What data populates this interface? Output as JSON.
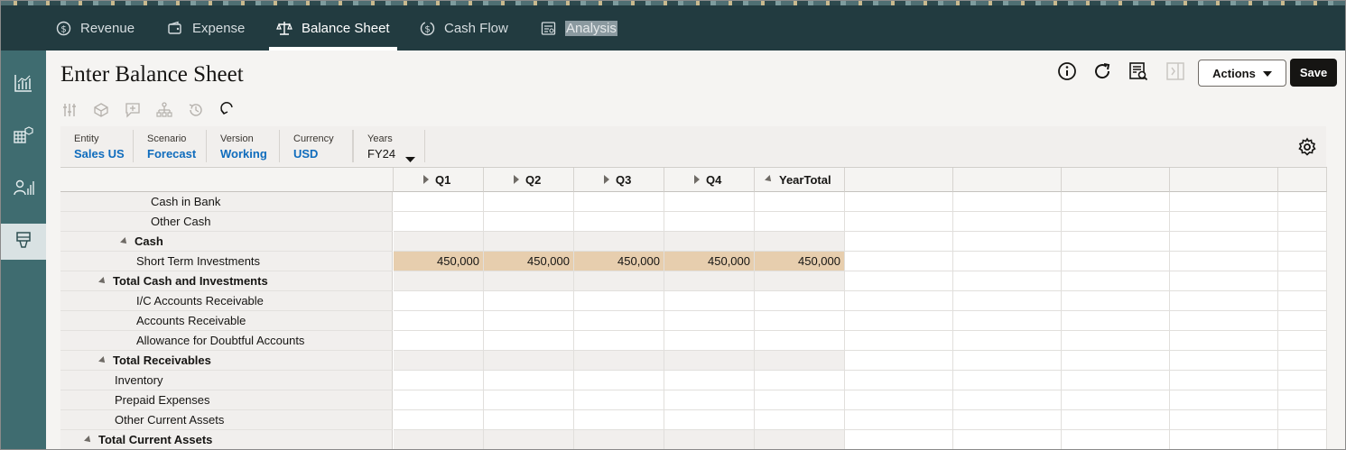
{
  "tabs": [
    {
      "label": "Revenue",
      "icon": "dollar-circle-icon"
    },
    {
      "label": "Expense",
      "icon": "wallet-icon"
    },
    {
      "label": "Balance Sheet",
      "icon": "scales-icon"
    },
    {
      "label": "Cash Flow",
      "icon": "dollar-flow-icon"
    },
    {
      "label": "Analysis",
      "icon": "report-icon"
    }
  ],
  "active_tab": "Balance Sheet",
  "rail": [
    {
      "icon": "bar-chart-icon"
    },
    {
      "icon": "grid-cube-icon"
    },
    {
      "icon": "person-chart-icon"
    },
    {
      "icon": "form-icon"
    }
  ],
  "page": {
    "title": "Enter Balance Sheet",
    "actions_label": "Actions",
    "save_label": "Save"
  },
  "pov": [
    {
      "label": "Entity",
      "value": "Sales US"
    },
    {
      "label": "Scenario",
      "value": "Forecast"
    },
    {
      "label": "Version",
      "value": "Working"
    },
    {
      "label": "Currency",
      "value": "USD"
    },
    {
      "label": "Years",
      "value": "FY24"
    }
  ],
  "grid": {
    "columns": [
      "Q1",
      "Q2",
      "Q3",
      "Q4",
      "YearTotal"
    ],
    "rows": [
      {
        "label": "Cash in Bank",
        "indent": 3,
        "bold": false,
        "style": "data",
        "values": [
          "",
          "",
          "",
          "",
          ""
        ]
      },
      {
        "label": "Other Cash",
        "indent": 3,
        "bold": false,
        "style": "data",
        "values": [
          "",
          "",
          "",
          "",
          ""
        ]
      },
      {
        "label": "Cash",
        "indent": 2,
        "bold": true,
        "style": "shade",
        "values": [
          "",
          "",
          "",
          "",
          ""
        ]
      },
      {
        "label": "Short Term Investments",
        "indent": 2,
        "bold": false,
        "style": "tan",
        "values": [
          "450,000",
          "450,000",
          "450,000",
          "450,000",
          "450,000"
        ]
      },
      {
        "label": "Total Cash and Investments",
        "indent": 1,
        "bold": true,
        "style": "shade",
        "values": [
          "",
          "",
          "",
          "",
          ""
        ]
      },
      {
        "label": "I/C Accounts Receivable",
        "indent": 2,
        "bold": false,
        "style": "data",
        "values": [
          "",
          "",
          "",
          "",
          ""
        ]
      },
      {
        "label": "Accounts Receivable",
        "indent": 2,
        "bold": false,
        "style": "data",
        "values": [
          "",
          "",
          "",
          "",
          ""
        ]
      },
      {
        "label": "Allowance for Doubtful Accounts",
        "indent": 2,
        "bold": false,
        "style": "data",
        "values": [
          "",
          "",
          "",
          "",
          ""
        ]
      },
      {
        "label": "Total Receivables",
        "indent": 1,
        "bold": true,
        "style": "shade",
        "values": [
          "",
          "",
          "",
          "",
          ""
        ]
      },
      {
        "label": "Inventory",
        "indent": 1,
        "bold": false,
        "style": "data",
        "values": [
          "",
          "",
          "",
          "",
          ""
        ]
      },
      {
        "label": "Prepaid Expenses",
        "indent": 1,
        "bold": false,
        "style": "data",
        "values": [
          "",
          "",
          "",
          "",
          ""
        ]
      },
      {
        "label": "Other Current Assets",
        "indent": 1,
        "bold": false,
        "style": "data",
        "values": [
          "",
          "",
          "",
          "",
          ""
        ]
      },
      {
        "label": "Total Current Assets",
        "indent": 0,
        "bold": true,
        "style": "shade",
        "values": [
          "",
          "",
          "",
          "",
          ""
        ]
      }
    ]
  }
}
